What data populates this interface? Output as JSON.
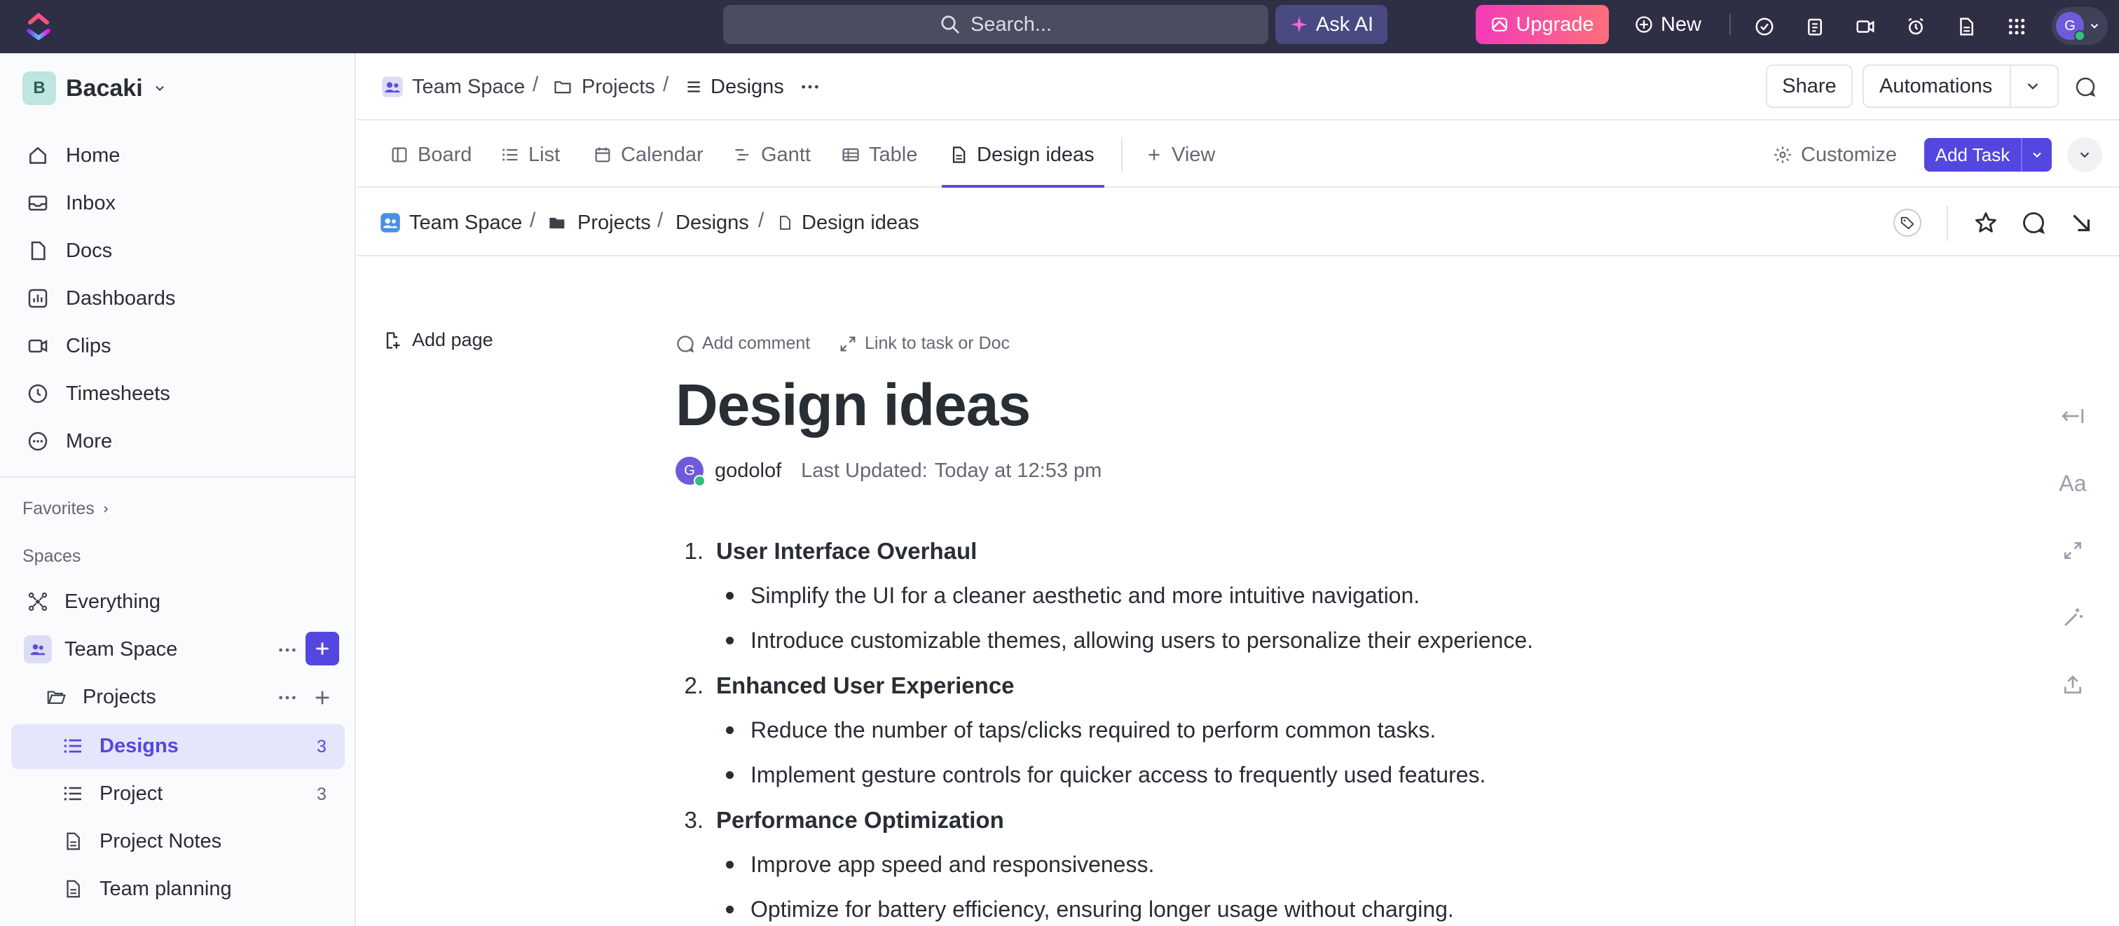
{
  "topbar": {
    "search_placeholder": "Search...",
    "ask_ai": "Ask AI",
    "upgrade": "Upgrade",
    "new": "New",
    "avatar_initial": "G"
  },
  "sidebar": {
    "workspace_initial": "B",
    "workspace_name": "Bacaki",
    "nav": [
      {
        "label": "Home",
        "icon": "home-icon"
      },
      {
        "label": "Inbox",
        "icon": "inbox-icon"
      },
      {
        "label": "Docs",
        "icon": "docs-icon"
      },
      {
        "label": "Dashboards",
        "icon": "dashboards-icon"
      },
      {
        "label": "Clips",
        "icon": "clips-icon"
      },
      {
        "label": "Timesheets",
        "icon": "timesheets-icon"
      },
      {
        "label": "More",
        "icon": "more-icon"
      }
    ],
    "favorites_label": "Favorites",
    "spaces_label": "Spaces",
    "tree": {
      "everything": "Everything",
      "team_space": "Team Space",
      "projects": "Projects",
      "designs": "Designs",
      "designs_count": "3",
      "project": "Project",
      "project_count": "3",
      "project_notes": "Project Notes",
      "team_planning": "Team planning"
    }
  },
  "header": {
    "breadcrumb": [
      "Team Space",
      "Projects",
      "Designs"
    ],
    "share": "Share",
    "automations": "Automations"
  },
  "tabs": {
    "board": "Board",
    "list": "List",
    "calendar": "Calendar",
    "gantt": "Gantt",
    "table": "Table",
    "design_ideas": "Design ideas",
    "view": "View",
    "customize": "Customize",
    "add_task": "Add Task"
  },
  "doc_breadcrumb": [
    "Team Space",
    "Projects",
    "Designs",
    "Design ideas"
  ],
  "doc": {
    "add_page": "Add page",
    "add_comment": "Add comment",
    "link_to": "Link to task or Doc",
    "title": "Design ideas",
    "author": "godolof",
    "author_initial": "G",
    "last_updated_label": "Last Updated:",
    "last_updated_value": "Today at 12:53 pm",
    "sections": [
      {
        "num": "1.",
        "heading": "User Interface Overhaul",
        "items": [
          "Simplify the UI for a cleaner aesthetic and more intuitive navigation.",
          "Introduce customizable themes, allowing users to personalize their experience."
        ]
      },
      {
        "num": "2.",
        "heading": "Enhanced User Experience",
        "items": [
          "Reduce the number of taps/clicks required to perform common tasks.",
          "Implement gesture controls for quicker access to frequently used features."
        ]
      },
      {
        "num": "3.",
        "heading": "Performance Optimization",
        "items": [
          "Improve app speed and responsiveness.",
          "Optimize for battery efficiency, ensuring longer usage without charging."
        ]
      }
    ]
  },
  "right_rail": {
    "font_label": "Aa"
  }
}
